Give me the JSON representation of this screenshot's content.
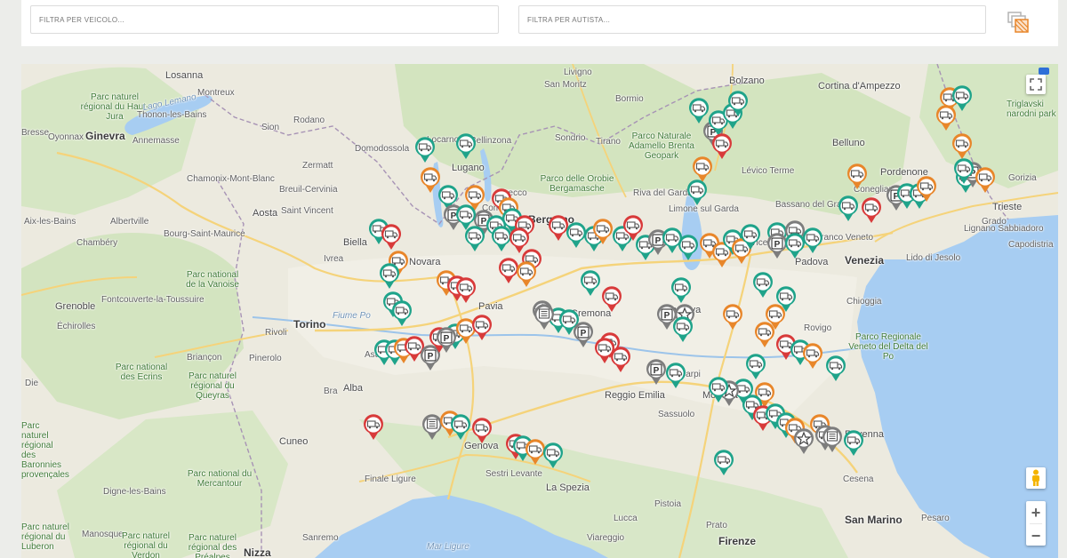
{
  "filters": {
    "vehicle_placeholder": "FILTRA PER VEICOLO...",
    "driver_placeholder": "FILTRA PER AUTISTA..."
  },
  "toolbar": {
    "fleet_icon": "vehicle-grid-icon"
  },
  "map_controls": {
    "fullscreen_icon": "fullscreen-icon",
    "pegman_icon": "pegman-icon",
    "zoom_in": "+",
    "zoom_out": "−",
    "flag_icon": "flag-icon"
  },
  "colors": {
    "teal": "#1fa38a",
    "orange": "#e8862a",
    "red": "#d83a3a",
    "grey": "#7d7d7d",
    "water": "#a7cdf2",
    "land": "#eceadf",
    "green": "#cfe3bd"
  },
  "marker_types": {
    "truck": "truck-icon",
    "parking": "parking-icon",
    "star": "star-icon",
    "trailer": "trailer-icon"
  },
  "places": [
    "Losanna",
    "Montreux",
    "Parc naturel régional du Haut-Jura",
    "Thonon-les-Bains",
    "Bresse",
    "Oyonnax",
    "Ginevra",
    "Annemasse",
    "Sion",
    "Rodano",
    "Aix-les-Bains",
    "Albertville",
    "Chambéry",
    "Chamonix-Mont-Blanc",
    "Zermatt",
    "Breuil-Cervinia",
    "Aosta",
    "Saint Vincent",
    "Bourg-Saint-Maurice",
    "Parc national de la Vanoise",
    "Grenoble",
    "Fontcouverte-la-Toussuire",
    "Échirolles",
    "Parc national des Ecrins",
    "Parc naturel régional du Queyras",
    "Die",
    "Parc naturel régional des Baronnies provençales",
    "Digne-les-Bains",
    "Parc national du Mercantour",
    "Manosque",
    "Parc naturel régional du Luberon",
    "Parc naturel régional du Verdon",
    "Parc naturel régional des Préalpes",
    "Nizza",
    "Sanremo",
    "Finale Ligure",
    "Cuneo",
    "Alba",
    "Bra",
    "Asti",
    "Pinerolo",
    "Briançon",
    "Rivoli",
    "Torino",
    "Fiume Po",
    "Biella",
    "Ivrea",
    "Novara",
    "Domodossola",
    "Locarno",
    "Lugano",
    "Bellinzona",
    "Como",
    "Lecco",
    "Bergamo",
    "Sondrio",
    "Tirano",
    "Bormio",
    "Livigno",
    "San Moritz",
    "Parco delle Orobie Bergamasche",
    "Parco Naturale Adamello Brenta Geopark",
    "Riva del Garda",
    "Limone sul Garda",
    "Bolzano",
    "Cortina d'Ampezzo",
    "Belluno",
    "Bassano del Grappa",
    "Conegliano",
    "Pordenone",
    "Vicenza",
    "Castelfranco Veneto",
    "Venezia",
    "Padova",
    "Lido di Jesolo",
    "Lignano Sabbiadoro",
    "Grado",
    "Gorizia",
    "Trieste",
    "Capodistria",
    "Chioggia",
    "Rovigo",
    "Parco Regionale Veneto del Delta del Po",
    "Pavia",
    "Cremona",
    "Mantova",
    "Carpi",
    "Modena",
    "Reggio Emilia",
    "Sassuolo",
    "Ravenna",
    "Cesena",
    "San Marino",
    "Pesaro",
    "Firenze",
    "Prato",
    "Pistoia",
    "Lucca",
    "Viareggio",
    "La Spezia",
    "Sestri Levante",
    "Genova",
    "Mar Ligure",
    "Triglavski narodni park",
    "Lago Lemano",
    "Lévico Terme"
  ]
}
